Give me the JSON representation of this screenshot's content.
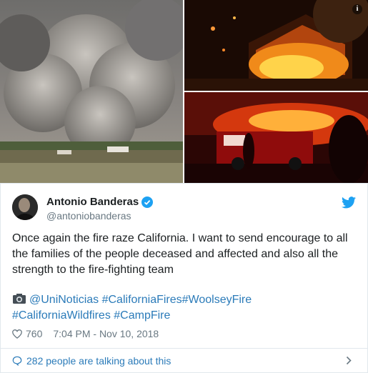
{
  "tweet": {
    "author_name": "Antonio Banderas",
    "handle": "@antoniobanderas",
    "text": "Once again the fire raze California. I want to send encourage to all the families of the people deceased and affected and also all the strength to the fire-fighting team",
    "tags_line1": "@UniNoticias #CaliforniaFires#WoolseyFire",
    "tags_line2": "#CaliforniaWildfires #CampFire",
    "likes": "760",
    "timestamp": "7:04 PM - Nov 10, 2018",
    "footer_text": "282 people are talking about this"
  },
  "icons": {
    "info": "info-icon",
    "verified": "verified-badge-icon",
    "brand": "twitter-bird-icon",
    "camera": "camera-icon",
    "like": "heart-icon",
    "talk": "speech-bubble-icon",
    "more": "chevron-right-icon"
  },
  "colors": {
    "link": "#2b7bb9",
    "muted": "#697882",
    "brand": "#1da1f2",
    "border": "#e1e8ed"
  }
}
